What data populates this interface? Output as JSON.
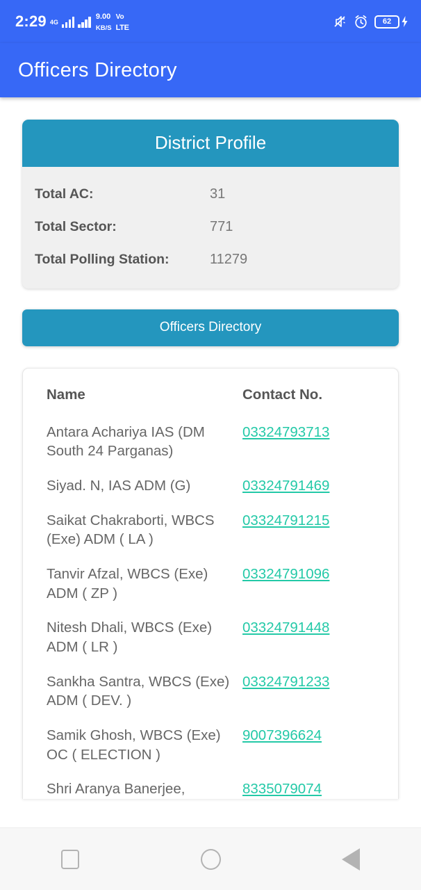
{
  "statusbar": {
    "time": "2:29",
    "network_type": "4G",
    "data_speed_value": "9.00",
    "data_speed_unit": "KB/S",
    "volte_top": "Vo",
    "volte_bottom": "LTE",
    "battery_level": "62",
    "icons": [
      "vibrate-mute-icon",
      "alarm-clock-icon",
      "battery-icon",
      "charging-bolt-icon"
    ]
  },
  "appbar": {
    "title": "Officers Directory",
    "background_color": "#3768f6"
  },
  "profile_card": {
    "title": "District Profile",
    "header_color": "#2496be",
    "rows": [
      {
        "label": "Total AC:",
        "value": "31"
      },
      {
        "label": "Total Sector:",
        "value": "771"
      },
      {
        "label": "Total Polling Station:",
        "value": "11279"
      }
    ]
  },
  "directory_button": {
    "label": "Officers Directory",
    "color": "#2496be"
  },
  "directory_table": {
    "columns": {
      "name": "Name",
      "contact": "Contact No."
    },
    "link_color": "#23c9a7",
    "rows": [
      {
        "name": "Antara Achariya IAS (DM South 24 Parganas)",
        "contact": "03324793713"
      },
      {
        "name": "Siyad. N, IAS  ADM (G)",
        "contact": "03324791469"
      },
      {
        "name": "Saikat Chakraborti, WBCS (Exe) ADM ( LA )",
        "contact": "03324791215"
      },
      {
        "name": "Tanvir Afzal, WBCS (Exe) ADM ( ZP )",
        "contact": "03324791096"
      },
      {
        "name": "Nitesh Dhali, WBCS (Exe) ADM ( LR )",
        "contact": "03324791448"
      },
      {
        "name": "Sankha Santra, WBCS (Exe) ADM  ( DEV. )",
        "contact": "03324791233"
      },
      {
        "name": "Samik Ghosh, WBCS (Exe) OC ( ELECTION )",
        "contact": "9007396624"
      },
      {
        "name": "Shri Aranya Banerjee,",
        "contact": "8335079074"
      }
    ]
  },
  "navbar": {
    "recents_label": "recents",
    "home_label": "home",
    "back_label": "back"
  }
}
